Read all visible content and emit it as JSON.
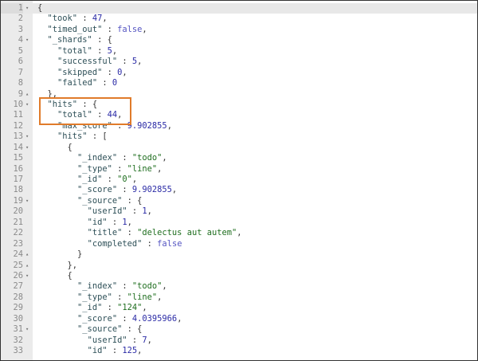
{
  "editor": {
    "active_line": 1,
    "highlight_color": "#e07b2a",
    "fold_icons": {
      "down": "▾",
      "up": "▴"
    },
    "lines": [
      {
        "n": "1",
        "fold": "down",
        "indent": 0,
        "pre": "{"
      },
      {
        "n": "2",
        "indent": 2,
        "key": "\"took\"",
        "sep": " : ",
        "value": "47",
        "vtype": "num",
        "tail": ","
      },
      {
        "n": "3",
        "indent": 2,
        "key": "\"timed_out\"",
        "sep": " : ",
        "value": "false",
        "vtype": "bool",
        "tail": ","
      },
      {
        "n": "4",
        "fold": "down",
        "indent": 2,
        "key": "\"_shards\"",
        "sep": " : ",
        "tail": "{"
      },
      {
        "n": "5",
        "indent": 4,
        "key": "\"total\"",
        "sep": " : ",
        "value": "5",
        "vtype": "num",
        "tail": ","
      },
      {
        "n": "6",
        "indent": 4,
        "key": "\"successful\"",
        "sep": " : ",
        "value": "5",
        "vtype": "num",
        "tail": ","
      },
      {
        "n": "7",
        "indent": 4,
        "key": "\"skipped\"",
        "sep": " : ",
        "value": "0",
        "vtype": "num",
        "tail": ","
      },
      {
        "n": "8",
        "indent": 4,
        "key": "\"failed\"",
        "sep": " : ",
        "value": "0",
        "vtype": "num"
      },
      {
        "n": "9",
        "fold": "up",
        "indent": 2,
        "pre": "},"
      },
      {
        "n": "10",
        "fold": "down",
        "indent": 2,
        "key": "\"hits\"",
        "sep": " : ",
        "tail": "{"
      },
      {
        "n": "11",
        "indent": 4,
        "key": "\"total\"",
        "sep": " : ",
        "value": "44",
        "vtype": "num",
        "tail": ","
      },
      {
        "n": "12",
        "indent": 4,
        "key": "\"max_score\"",
        "sep": " : ",
        "value": "9.902855",
        "vtype": "num",
        "tail": ","
      },
      {
        "n": "13",
        "fold": "down",
        "indent": 4,
        "key": "\"hits\"",
        "sep": " : ",
        "tail": "["
      },
      {
        "n": "14",
        "fold": "down",
        "indent": 6,
        "pre": "{"
      },
      {
        "n": "15",
        "indent": 8,
        "key": "\"_index\"",
        "sep": " : ",
        "value": "\"todo\"",
        "vtype": "str",
        "tail": ","
      },
      {
        "n": "16",
        "indent": 8,
        "key": "\"_type\"",
        "sep": " : ",
        "value": "\"line\"",
        "vtype": "str",
        "tail": ","
      },
      {
        "n": "17",
        "indent": 8,
        "key": "\"_id\"",
        "sep": " : ",
        "value": "\"0\"",
        "vtype": "str",
        "tail": ","
      },
      {
        "n": "18",
        "indent": 8,
        "key": "\"_score\"",
        "sep": " : ",
        "value": "9.902855",
        "vtype": "num",
        "tail": ","
      },
      {
        "n": "19",
        "fold": "down",
        "indent": 8,
        "key": "\"_source\"",
        "sep": " : ",
        "tail": "{"
      },
      {
        "n": "20",
        "indent": 10,
        "key": "\"userId\"",
        "sep": " : ",
        "value": "1",
        "vtype": "num",
        "tail": ","
      },
      {
        "n": "21",
        "indent": 10,
        "key": "\"id\"",
        "sep": " : ",
        "value": "1",
        "vtype": "num",
        "tail": ","
      },
      {
        "n": "22",
        "indent": 10,
        "key": "\"title\"",
        "sep": " : ",
        "value": "\"delectus aut autem\"",
        "vtype": "str",
        "tail": ","
      },
      {
        "n": "23",
        "indent": 10,
        "key": "\"completed\"",
        "sep": " : ",
        "value": "false",
        "vtype": "bool"
      },
      {
        "n": "24",
        "fold": "up",
        "indent": 8,
        "pre": "}"
      },
      {
        "n": "25",
        "fold": "up",
        "indent": 6,
        "pre": "},"
      },
      {
        "n": "26",
        "fold": "down",
        "indent": 6,
        "pre": "{"
      },
      {
        "n": "27",
        "indent": 8,
        "key": "\"_index\"",
        "sep": " : ",
        "value": "\"todo\"",
        "vtype": "str",
        "tail": ","
      },
      {
        "n": "28",
        "indent": 8,
        "key": "\"_type\"",
        "sep": " : ",
        "value": "\"line\"",
        "vtype": "str",
        "tail": ","
      },
      {
        "n": "29",
        "indent": 8,
        "key": "\"_id\"",
        "sep": " : ",
        "value": "\"124\"",
        "vtype": "str",
        "tail": ","
      },
      {
        "n": "30",
        "indent": 8,
        "key": "\"_score\"",
        "sep": " : ",
        "value": "4.0395966",
        "vtype": "num",
        "tail": ","
      },
      {
        "n": "31",
        "fold": "down",
        "indent": 8,
        "key": "\"_source\"",
        "sep": " : ",
        "tail": "{"
      },
      {
        "n": "32",
        "indent": 10,
        "key": "\"userId\"",
        "sep": " : ",
        "value": "7",
        "vtype": "num",
        "tail": ","
      },
      {
        "n": "33",
        "indent": 10,
        "key": "\"id\"",
        "sep": " : ",
        "value": "125",
        "vtype": "num",
        "tail": ","
      }
    ]
  }
}
